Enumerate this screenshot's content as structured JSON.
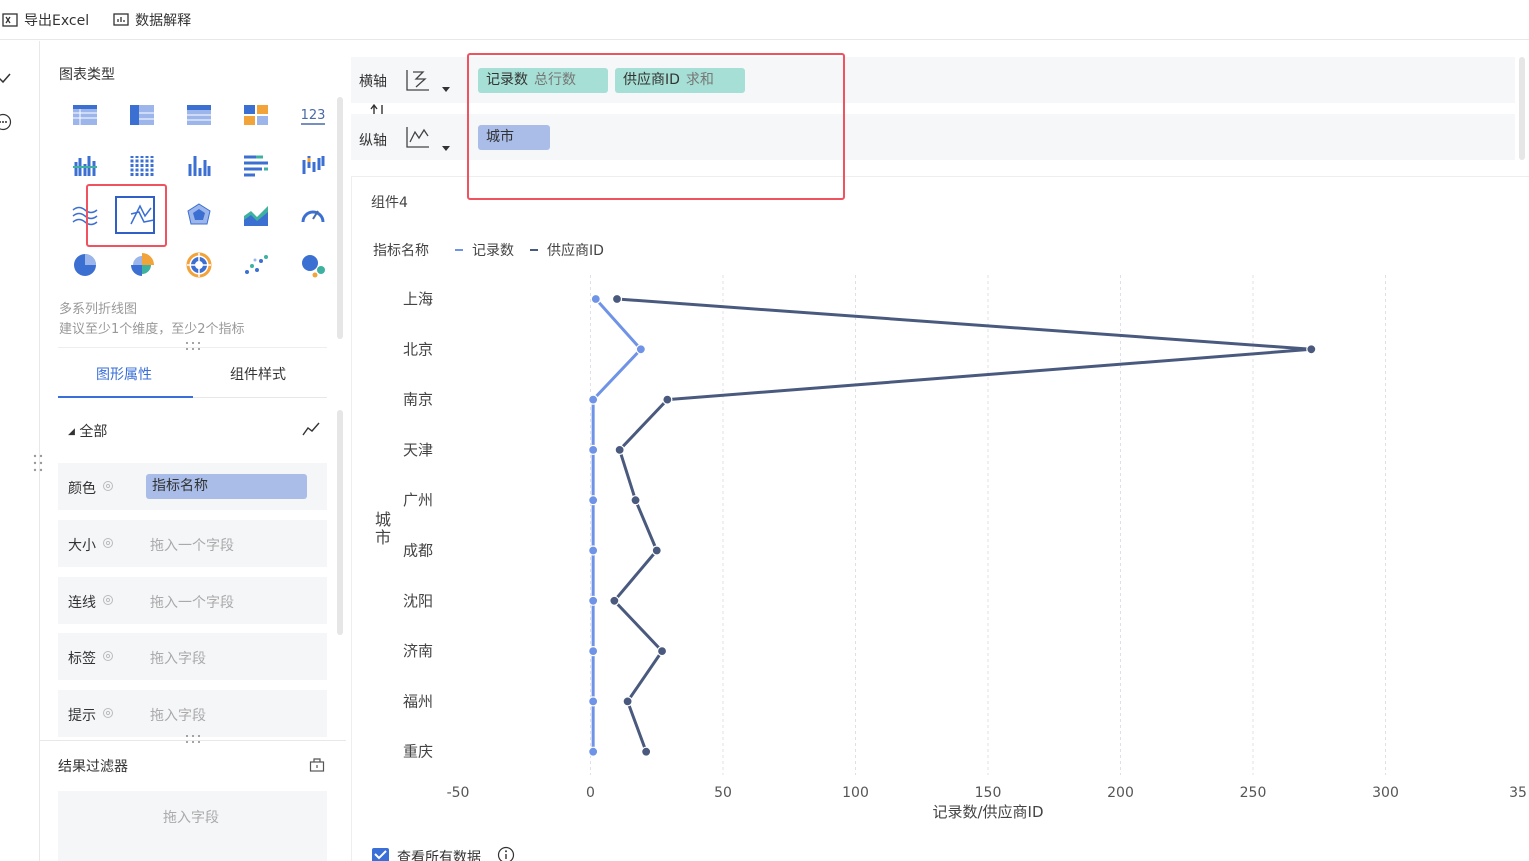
{
  "toolbar": {
    "export_label": "导出Excel",
    "explain_label": "数据解释"
  },
  "chart_type_section": {
    "title": "图表类型",
    "selected_name": "多系列折线图",
    "selected_hint": "建议至少1个维度，至少2个指标"
  },
  "chart_type_icons": [
    "table-icon",
    "pivot-table-icon",
    "detail-table-icon",
    "cross-table-icon",
    "kpi-number-icon",
    "grouped-bar-icon",
    "stacked-column-icon",
    "column-chart-icon",
    "horizontal-bar-icon",
    "range-column-icon",
    "multi-line-wave-icon",
    "multi-series-line-icon",
    "radar-icon",
    "area-chart-icon",
    "gauge-icon",
    "pie-chart-icon",
    "rose-pie-icon",
    "sunburst-icon",
    "scatter-icon",
    "bubble-icon"
  ],
  "tabs": {
    "shape_props": "图形属性",
    "component_style": "组件样式"
  },
  "props": {
    "group_label": "全部",
    "color": {
      "label": "颜色",
      "value": "指标名称"
    },
    "size": {
      "label": "大小",
      "placeholder": "拖入一个字段"
    },
    "connect": {
      "label": "连线",
      "placeholder": "拖入一个字段"
    },
    "tag": {
      "label": "标签",
      "placeholder": "拖入字段"
    },
    "tooltip": {
      "label": "提示",
      "placeholder": "拖入字段"
    }
  },
  "filter": {
    "title": "结果过滤器",
    "placeholder": "拖入字段"
  },
  "axes": {
    "x_label": "横轴",
    "y_label": "纵轴",
    "x_fields": [
      {
        "name": "记录数",
        "agg": "总行数"
      },
      {
        "name": "供应商ID",
        "agg": "求和"
      }
    ],
    "y_fields": [
      {
        "name": "城市"
      }
    ]
  },
  "component": {
    "title": "组件4"
  },
  "view_all": {
    "label": "查看所有数据"
  },
  "colors": {
    "accent": "#3a6fd8",
    "series1": "#6f93e6",
    "series2": "#4a5a7e",
    "highlight": "#f0525f",
    "pill_green": "#a6dfd5",
    "pill_blue": "#a9bde8"
  },
  "chart_data": {
    "type": "line",
    "orientation": "horizontal",
    "legend_title": "指标名称",
    "legend_placement": "top-left",
    "categories": [
      "上海",
      "北京",
      "南京",
      "天津",
      "广州",
      "成都",
      "沈阳",
      "济南",
      "福州",
      "重庆"
    ],
    "series": [
      {
        "name": "记录数",
        "values": [
          2,
          19,
          1,
          1,
          1,
          1,
          1,
          1,
          1,
          1
        ]
      },
      {
        "name": "供应商ID",
        "values": [
          10,
          272,
          29,
          11,
          17,
          25,
          9,
          27,
          14,
          21
        ]
      }
    ],
    "xlabel": "记录数/供应商ID",
    "ylabel": "城市",
    "xticks": [
      "-50",
      "0",
      "50",
      "100",
      "150",
      "200",
      "250",
      "300",
      "35"
    ],
    "xlim": [
      -50,
      350
    ],
    "grid": true
  }
}
